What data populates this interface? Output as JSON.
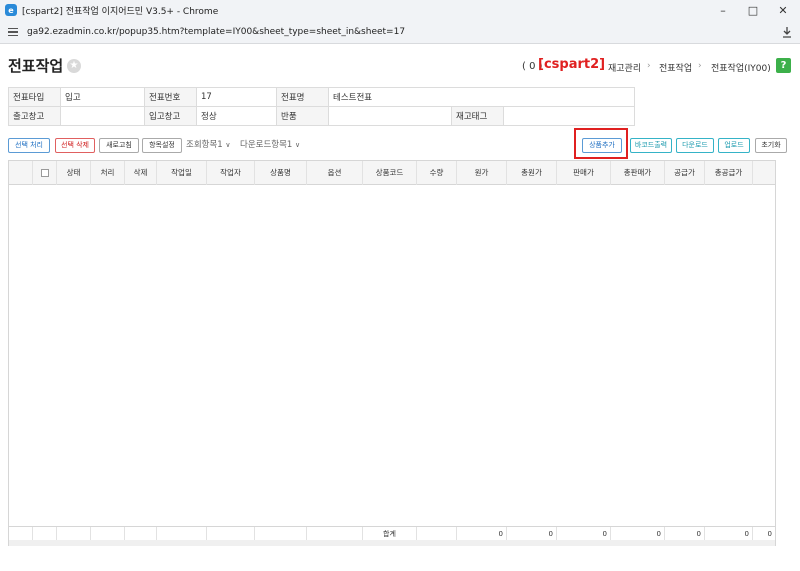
{
  "window": {
    "title": "[cspart2] 전표작업 이지어드민 V3.5+ - Chrome",
    "url": "ga92.ezadmin.co.kr/popup35.htm?template=IY00&sheet_type=sheet_in&sheet=17"
  },
  "header": {
    "title": "전표작업",
    "count": "( 0 )",
    "account": "[cspart2]",
    "breadcrumb": [
      "재고관리",
      "전표작업",
      "전표작업(IY00)"
    ],
    "help": "?"
  },
  "info": {
    "row1": [
      {
        "label": "전표타입",
        "value": "입고"
      },
      {
        "label": "전표번호",
        "value": "17"
      },
      {
        "label": "전표명",
        "value": "테스트전표"
      }
    ],
    "row2": [
      {
        "label": "출고창고",
        "value": ""
      },
      {
        "label": "입고창고",
        "value": "정상"
      },
      {
        "label": "반품",
        "value": ""
      },
      {
        "label": "재고태그",
        "value": ""
      }
    ]
  },
  "toolbar": {
    "select_process": "선택 처리",
    "select_delete": "선택 삭제",
    "refresh": "새로고침",
    "column_settings": "항목설정",
    "view_items": "조회항목1",
    "download_items": "다운로드항목1",
    "add_product": "상품추가",
    "barcode_print": "바코드출력",
    "download": "다운로드",
    "upload": "업로드",
    "reset": "초기화"
  },
  "grid": {
    "columns": [
      "상태",
      "처리",
      "삭제",
      "작업일",
      "작업자",
      "상품명",
      "옵션",
      "상품코드",
      "수량",
      "원가",
      "총원가",
      "판매가",
      "총판매가",
      "공급가",
      "총공급가"
    ],
    "footer": {
      "label": "합계",
      "totals": [
        "0",
        "0",
        "0",
        "0",
        "0",
        "0",
        "0"
      ]
    }
  },
  "colors": {
    "highlight": "#e02020",
    "help_green": "#3cb04a"
  }
}
